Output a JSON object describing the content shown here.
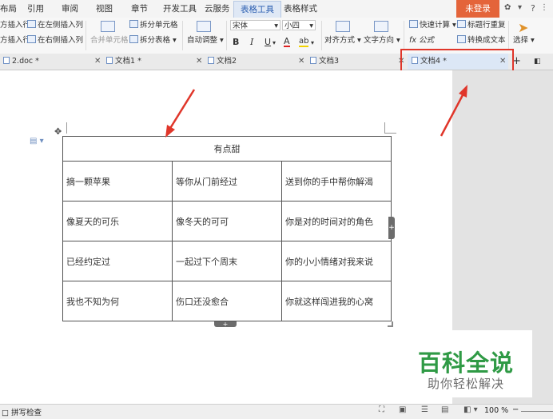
{
  "menubar": {
    "items": [
      "布局",
      "引用",
      "审阅",
      "视图",
      "章节",
      "开发工具",
      "云服务"
    ],
    "table_tools": "表格工具",
    "table_style": "表格样式",
    "login": "未登录",
    "help": "?"
  },
  "ribbon": {
    "insert_above": "方插入行",
    "insert_left": "在左侧插入列",
    "insert_below": "方插入行",
    "insert_right": "在右侧插入列",
    "merge_cells": "合并单元格",
    "split_cells": "拆分单元格",
    "split_table": "拆分表格",
    "auto_fit": "自动调整",
    "font_name": "宋体",
    "font_size": "小四",
    "bold": "B",
    "italic": "I",
    "underline": "U",
    "font_color": "A",
    "highlight": "ab",
    "align": "对齐方式",
    "text_direction": "文字方向",
    "quick_calc": "快速计算",
    "repeat_header": "标题行重复",
    "formula": "fx 公式",
    "convert_text": "转换成文本",
    "select": "选择"
  },
  "tabs": [
    {
      "label": "2.doc *"
    },
    {
      "label": "文档1 *"
    },
    {
      "label": "文档2"
    },
    {
      "label": "文档3"
    },
    {
      "label": "文档4 *"
    }
  ],
  "add_tab": "+",
  "table": {
    "header": "有点甜",
    "rows": [
      [
        "摘一颗苹果",
        "等你从门前经过",
        "送到你的手中帮你解渴"
      ],
      [
        "像夏天的可乐",
        "像冬天的可可",
        "你是对的时间对的角色"
      ],
      [
        "已经约定过",
        "一起过下个周末",
        "你的小小情绪对我来说"
      ],
      [
        "我也不知为何",
        "伤口还没愈合",
        "你就这样闯进我的心窝"
      ]
    ]
  },
  "statusbar": {
    "spell_check": "拼写检查",
    "zoom": "100 %"
  },
  "watermark": {
    "title": "百科全说",
    "subtitle": "助你轻松解决"
  },
  "colors": {
    "arrow": "#e0362a",
    "highlight_box": "#e0362a",
    "watermark_green": "#2f9a45",
    "login_bg": "#e4643a"
  }
}
